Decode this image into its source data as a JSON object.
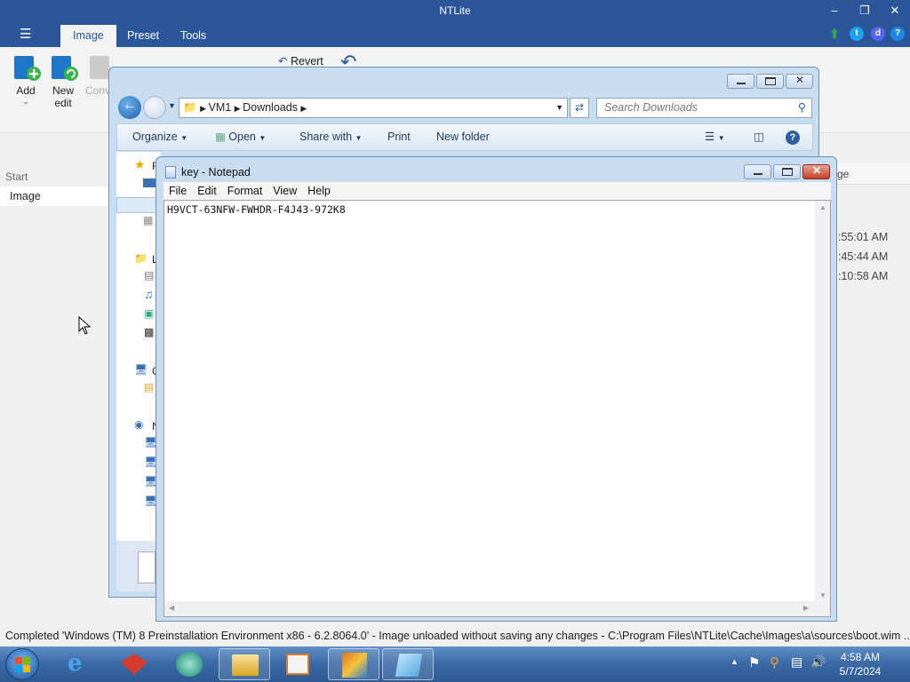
{
  "ntlite": {
    "title": "NTLite",
    "tabs": [
      "Image",
      "Preset",
      "Tools"
    ],
    "ribbon": {
      "add": "Add",
      "new_edit": "New\nedit",
      "convert": "Conv",
      "revert": "Revert"
    },
    "left_header": "Start",
    "left_item": "Image",
    "right_col": "ge",
    "right_times": [
      ":55:01 AM",
      ":45:44 AM",
      ":10:58 AM"
    ],
    "status": "Completed  'Windows (TM) 8 Preinstallation Environment x86 - 6.2.8064.0' - Image unloaded without saving any changes - C:\\Program Files\\NTLite\\Cache\\Images\\a\\sources\\boot.wim ..."
  },
  "explorer": {
    "breadcrumb": [
      "VM1",
      "Downloads"
    ],
    "search_placeholder": "Search Downloads",
    "toolbar": {
      "organize": "Organize",
      "open": "Open",
      "share_with": "Share with",
      "print": "Print",
      "new_folder": "New folder"
    },
    "nav_letters": [
      "F",
      "L",
      "C",
      "N"
    ]
  },
  "notepad": {
    "title": "key - Notepad",
    "menu": [
      "File",
      "Edit",
      "Format",
      "View",
      "Help"
    ],
    "content": "H9VCT-63NFW-FWHDR-F4J43-972K8"
  },
  "taskbar": {
    "time": "4:58 AM",
    "date": "5/7/2024"
  },
  "colors": {
    "ntlite_blue": "#2b579a",
    "taskbar_blue": "#3d6ba6",
    "aero_frame": "#c9ddf1"
  }
}
